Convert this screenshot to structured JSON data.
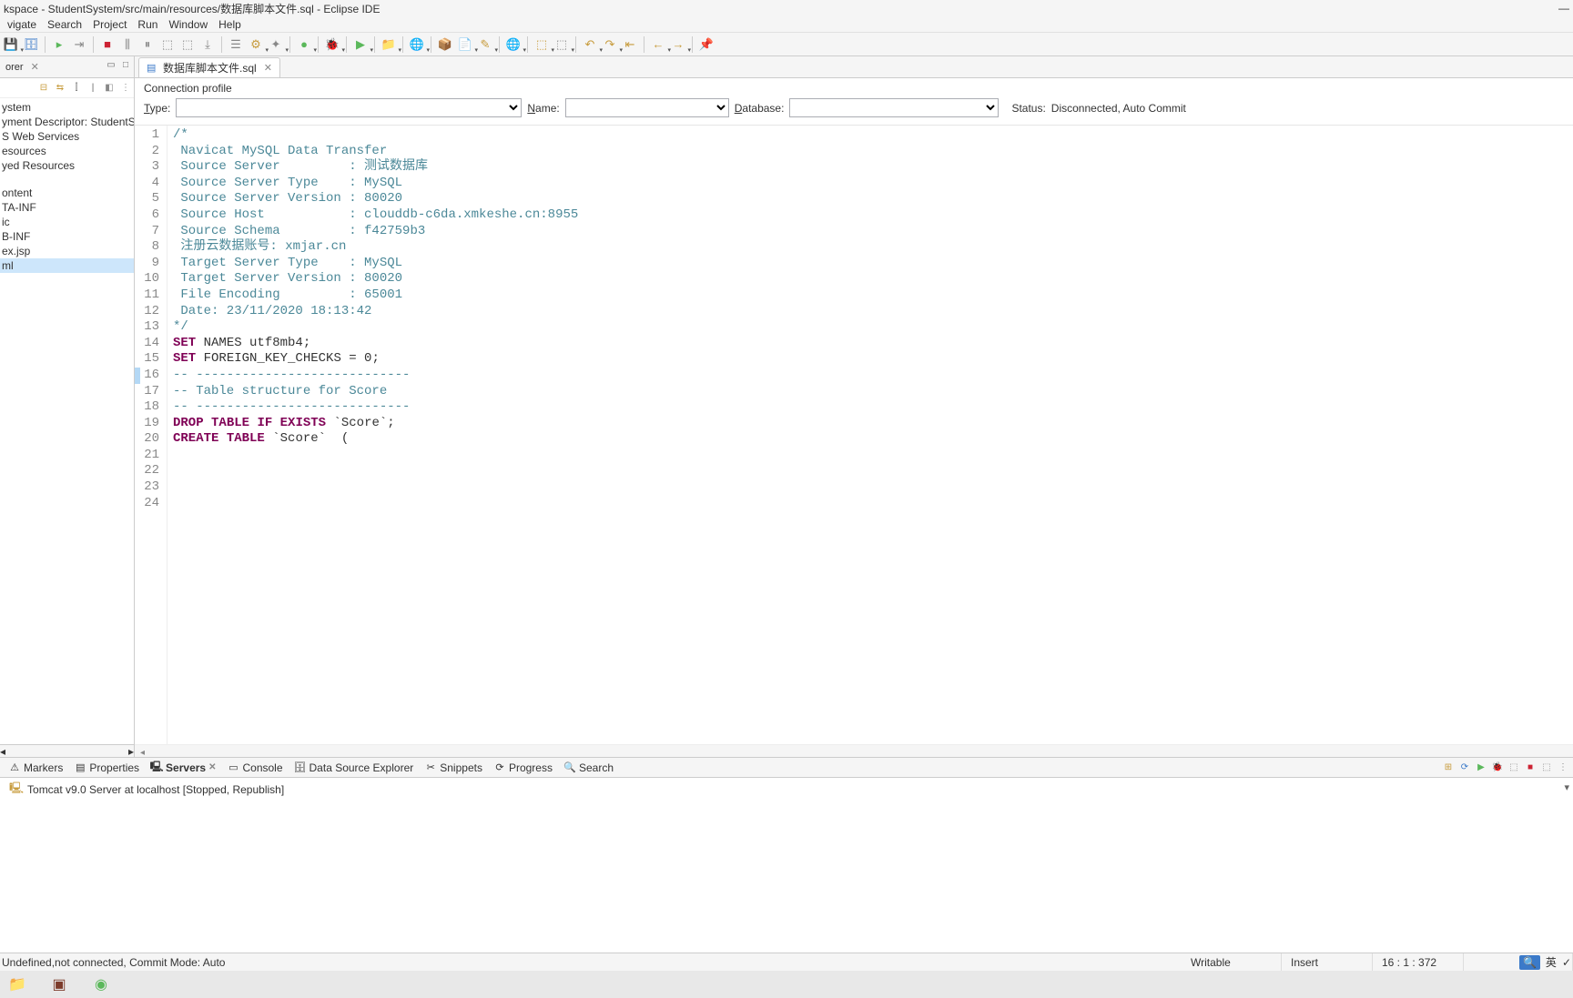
{
  "titlebar": "kspace - StudentSystem/src/main/resources/数据库脚本文件.sql - Eclipse IDE",
  "menu": [
    "vigate",
    "Search",
    "Project",
    "Run",
    "Window",
    "Help"
  ],
  "sidebar": {
    "tab": "orer",
    "tree": [
      "ystem",
      "yment Descriptor: StudentSystem",
      "S Web Services",
      "esources",
      "yed Resources",
      "",
      "ontent",
      "TA-INF",
      "ic",
      "B-INF",
      "ex.jsp",
      "ml"
    ],
    "selected_index": 11
  },
  "editor_tab": {
    "filename": "数据库脚本文件.sql"
  },
  "conn": {
    "section": "Connection profile",
    "type_lbl": "Type:",
    "name_lbl": "Name:",
    "db_lbl": "Database:",
    "status_lbl": "Status:",
    "status_val": "Disconnected, Auto Commit"
  },
  "code": [
    {
      "n": 1,
      "t": "/*",
      "cls": "cmt"
    },
    {
      "n": 2,
      "t": " Navicat MySQL Data Transfer",
      "cls": "cmt"
    },
    {
      "n": 3,
      "t": "",
      "cls": "cmt"
    },
    {
      "n": 4,
      "t": " Source Server         : 测试数据库",
      "cls": "cmt"
    },
    {
      "n": 5,
      "t": " Source Server Type    : MySQL",
      "cls": "cmt"
    },
    {
      "n": 6,
      "t": " Source Server Version : 80020",
      "cls": "cmt"
    },
    {
      "n": 7,
      "t": " Source Host           : clouddb-c6da.xmkeshe.cn:8955",
      "cls": "cmt"
    },
    {
      "n": 8,
      "t": " Source Schema         : f42759b3",
      "cls": "cmt"
    },
    {
      "n": 9,
      "t": " 注册云数据账号: xmjar.cn",
      "cls": "cmt"
    },
    {
      "n": 10,
      "t": " Target Server Type    : MySQL",
      "cls": "cmt"
    },
    {
      "n": 11,
      "t": " Target Server Version : 80020",
      "cls": "cmt"
    },
    {
      "n": 12,
      "t": " File Encoding         : 65001",
      "cls": "cmt"
    },
    {
      "n": 13,
      "t": "",
      "cls": "cmt"
    },
    {
      "n": 14,
      "t": " Date: 23/11/2020 18:13:42",
      "cls": "cmt"
    },
    {
      "n": 15,
      "t": "*/",
      "cls": "cmt"
    },
    {
      "n": 16,
      "t": "",
      "cls": "",
      "hl": true
    },
    {
      "n": 17,
      "html": "<span class='kw'>SET</span> NAMES utf8mb4;"
    },
    {
      "n": 18,
      "html": "<span class='kw'>SET</span> FOREIGN_KEY_CHECKS = 0;"
    },
    {
      "n": 19,
      "t": "",
      "cls": ""
    },
    {
      "n": 20,
      "t": "-- ----------------------------",
      "cls": "cmt"
    },
    {
      "n": 21,
      "t": "-- Table structure for Score",
      "cls": "cmt"
    },
    {
      "n": 22,
      "t": "-- ----------------------------",
      "cls": "cmt"
    },
    {
      "n": 23,
      "html": "<span class='kw'>DROP</span> <span class='kw'>TABLE</span> <span class='kw'>IF</span> <span class='kw'>EXISTS</span> `Score`;"
    },
    {
      "n": 24,
      "html": "<span class='kw'>CREATE</span> <span class='kw'>TABLE</span> `Score`  ("
    }
  ],
  "bottom_tabs": [
    "Markers",
    "Properties",
    "Servers",
    "Console",
    "Data Source Explorer",
    "Snippets",
    "Progress",
    "Search"
  ],
  "bottom_active": 2,
  "server_line": "Tomcat v9.0 Server at localhost  [Stopped, Republish]",
  "status": {
    "left": "Undefined,not connected, Commit Mode: Auto",
    "writable": "Writable",
    "insert": "Insert",
    "pos": "16 : 1 : 372"
  },
  "lang": "英"
}
